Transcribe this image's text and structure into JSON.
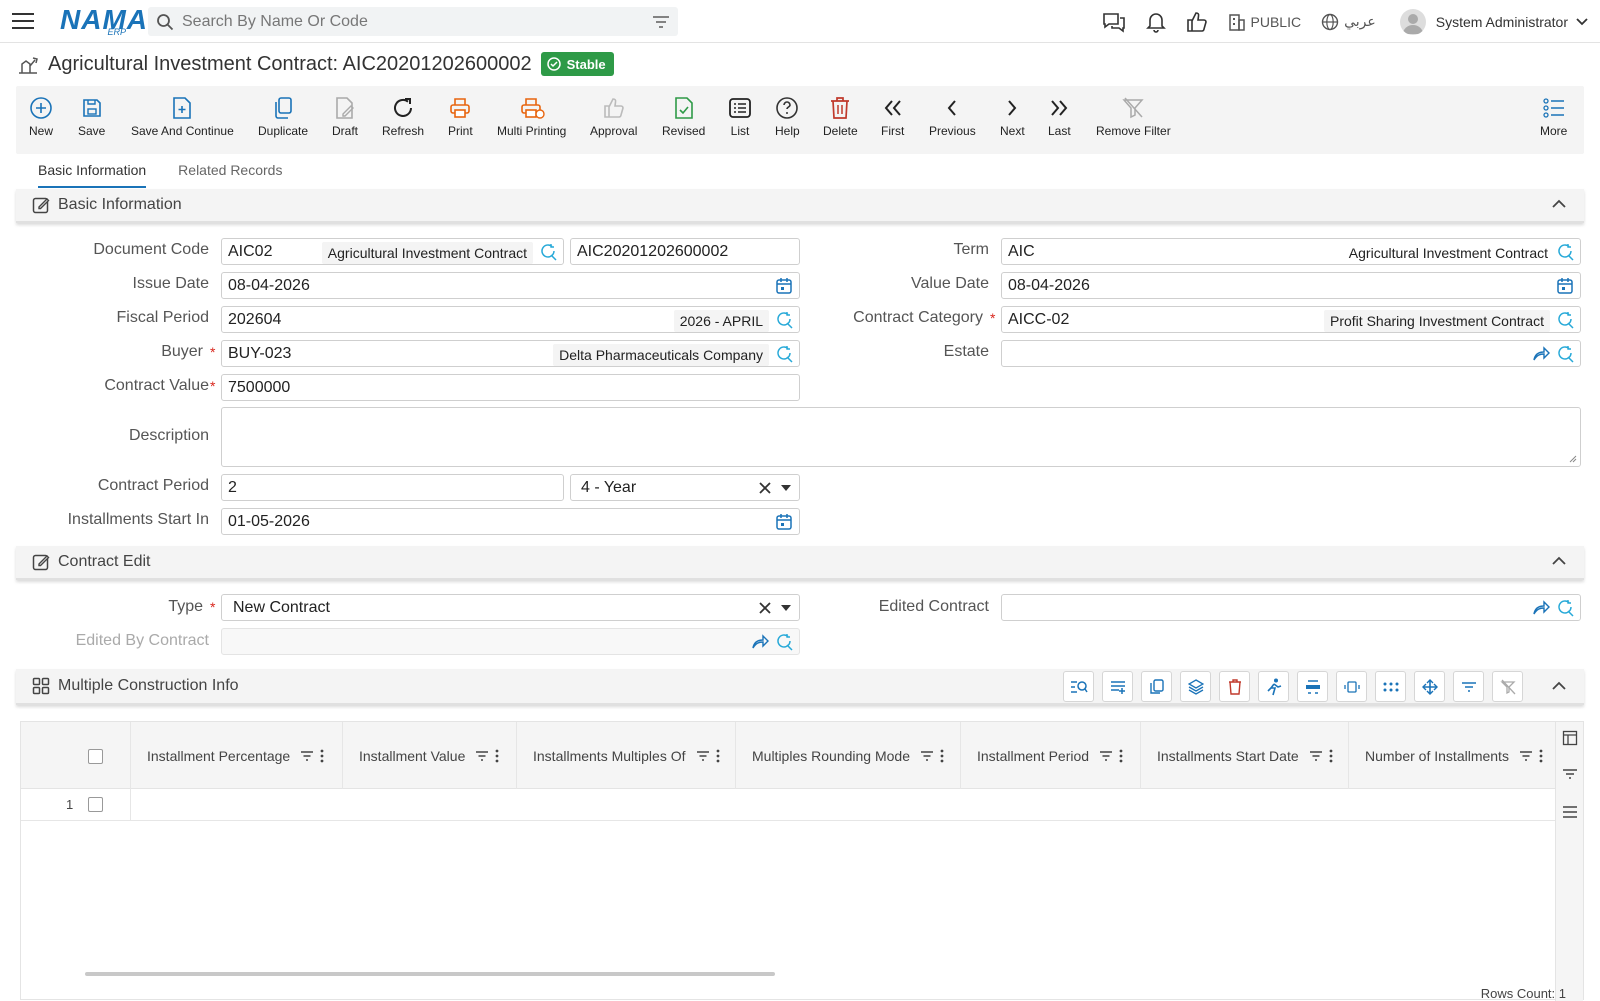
{
  "app": {
    "logo_main": "NAMA",
    "logo_sub": "ERP"
  },
  "search": {
    "placeholder": "Search By Name Or Code"
  },
  "topbar": {
    "company": "PUBLIC",
    "language": "عربي",
    "user": "System Administrator"
  },
  "page": {
    "title": "Agricultural Investment Contract: AIC20201202600002",
    "status": "Stable"
  },
  "toolbar": {
    "new": "New",
    "save": "Save",
    "save_continue": "Save And Continue",
    "duplicate": "Duplicate",
    "draft": "Draft",
    "refresh": "Refresh",
    "print": "Print",
    "multi_printing": "Multi Printing",
    "approval": "Approval",
    "revised": "Revised",
    "list": "List",
    "help": "Help",
    "delete": "Delete",
    "first": "First",
    "previous": "Previous",
    "next": "Next",
    "last": "Last",
    "remove_filter": "Remove Filter",
    "more": "More"
  },
  "tabs": {
    "basic": "Basic Information",
    "related": "Related Records"
  },
  "sections": {
    "basic": "Basic Information",
    "contract_edit": "Contract Edit",
    "construction": "Multiple Construction Info"
  },
  "form": {
    "document_code": {
      "label": "Document Code",
      "code": "AIC02",
      "desc": "Agricultural Investment Contract",
      "number": "AIC20201202600002"
    },
    "term": {
      "label": "Term",
      "code": "AIC",
      "desc": "Agricultural Investment Contract"
    },
    "issue_date": {
      "label": "Issue Date",
      "value": "08-04-2026"
    },
    "value_date": {
      "label": "Value Date",
      "value": "08-04-2026"
    },
    "fiscal_period": {
      "label": "Fiscal Period",
      "code": "202604",
      "desc": "2026 - APRIL"
    },
    "contract_category": {
      "label": "Contract Category",
      "code": "AICC-02",
      "desc": "Profit Sharing Investment Contract"
    },
    "buyer": {
      "label": "Buyer",
      "code": "BUY-023",
      "desc": "Delta Pharmaceuticals Company"
    },
    "estate": {
      "label": "Estate",
      "value": ""
    },
    "contract_value": {
      "label": "Contract Value",
      "value": "7500000"
    },
    "description": {
      "label": "Description",
      "value": ""
    },
    "contract_period": {
      "label": "Contract Period",
      "value": "2",
      "unit": "4 - Year"
    },
    "installments_start": {
      "label": "Installments Start In",
      "value": "01-05-2026"
    },
    "type": {
      "label": "Type",
      "value": "New Contract"
    },
    "edited_contract": {
      "label": "Edited Contract",
      "value": ""
    },
    "edited_by_contract": {
      "label": "Edited By Contract",
      "value": ""
    }
  },
  "grid": {
    "columns": [
      "Installment Percentage",
      "Installment Value",
      "Installments Multiples Of",
      "Multiples Rounding Mode",
      "Installment Period",
      "Installments Start Date",
      "Number of Installments"
    ],
    "rows": [
      {
        "num": "1"
      }
    ],
    "rows_count": "Rows Count: 1"
  },
  "colors": {
    "accent": "#1a73b8",
    "status_green": "#2e9a47",
    "print_orange": "#e8650f",
    "delete_red": "#c0392b"
  }
}
